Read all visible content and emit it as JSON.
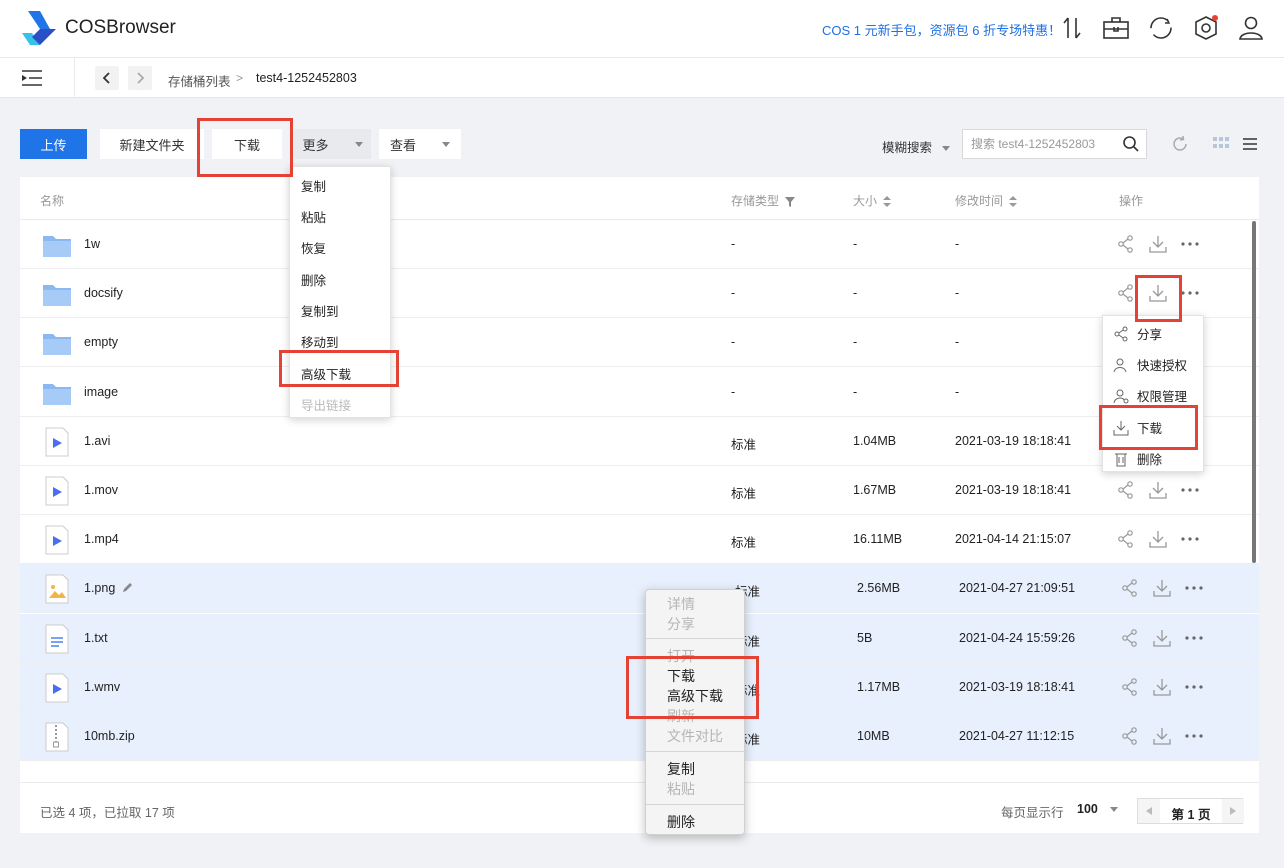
{
  "app": {
    "title": "COSBrowser",
    "promo": "COS 1 元新手包，资源包 6 折专场特惠！"
  },
  "header_icons": [
    "transfer-icon",
    "toolbox-icon",
    "sync-icon",
    "settings-icon",
    "user-icon"
  ],
  "breadcrumb": {
    "root": "存储桶列表",
    "current": "test4-1252452803"
  },
  "toolbar": {
    "upload": "上传",
    "new_folder": "新建文件夹",
    "download": "下载",
    "more": "更多",
    "view": "查看",
    "search_mode": "模糊搜索",
    "search_placeholder": "搜索 test4-1252452803"
  },
  "table": {
    "headers": {
      "name": "名称",
      "storage": "存储类型",
      "size": "大小",
      "mtime": "修改时间",
      "ops": "操作"
    },
    "rows": [
      {
        "name": "1w",
        "storage": "-",
        "size": "-",
        "mtime": "-"
      },
      {
        "name": "docsify",
        "storage": "-",
        "size": "-",
        "mtime": "-"
      },
      {
        "name": "empty",
        "storage": "-",
        "size": "-",
        "mtime": "-"
      },
      {
        "name": "image",
        "storage": "-",
        "size": "-",
        "mtime": "-"
      },
      {
        "name": "1.avi",
        "storage": "标准",
        "size": "1.04MB",
        "mtime": "2021-03-19 18:18:41"
      },
      {
        "name": "1.mov",
        "storage": "标准",
        "size": "1.67MB",
        "mtime": "2021-03-19 18:18:41"
      },
      {
        "name": "1.mp4",
        "storage": "标准",
        "size": "16.11MB",
        "mtime": "2021-04-14 21:15:07"
      },
      {
        "name": "1.png",
        "storage": "标准",
        "size": "2.56MB",
        "mtime": "2021-04-27 21:09:51"
      },
      {
        "name": "1.txt",
        "storage": "标准",
        "size": "5B",
        "mtime": "2021-04-24 15:59:26"
      },
      {
        "name": "1.wmv",
        "storage": "标准",
        "size": "1.17MB",
        "mtime": "2021-03-19 18:18:41"
      },
      {
        "name": "10mb.zip",
        "storage": "标准",
        "size": "10MB",
        "mtime": "2021-04-27 11:12:15"
      }
    ]
  },
  "more_menu": [
    "复制",
    "粘贴",
    "恢复",
    "删除",
    "复制到",
    "移动到",
    "高级下载",
    "导出链接"
  ],
  "row_menu": [
    "分享",
    "快速授权",
    "权限管理",
    "下载",
    "删除"
  ],
  "context_menu": [
    "详情",
    "分享",
    "打开",
    "下载",
    "高级下载",
    "刷新",
    "文件对比",
    "复制",
    "粘贴",
    "删除"
  ],
  "footer": {
    "status": "已选 4 项，已拉取 17 项",
    "page_size_label": "每页显示行",
    "page_size": "100",
    "page": "第 1 页"
  },
  "colors": {
    "primary": "#1f74e8",
    "highlight": "#e34234",
    "selected_row": "#e8f0fd"
  }
}
